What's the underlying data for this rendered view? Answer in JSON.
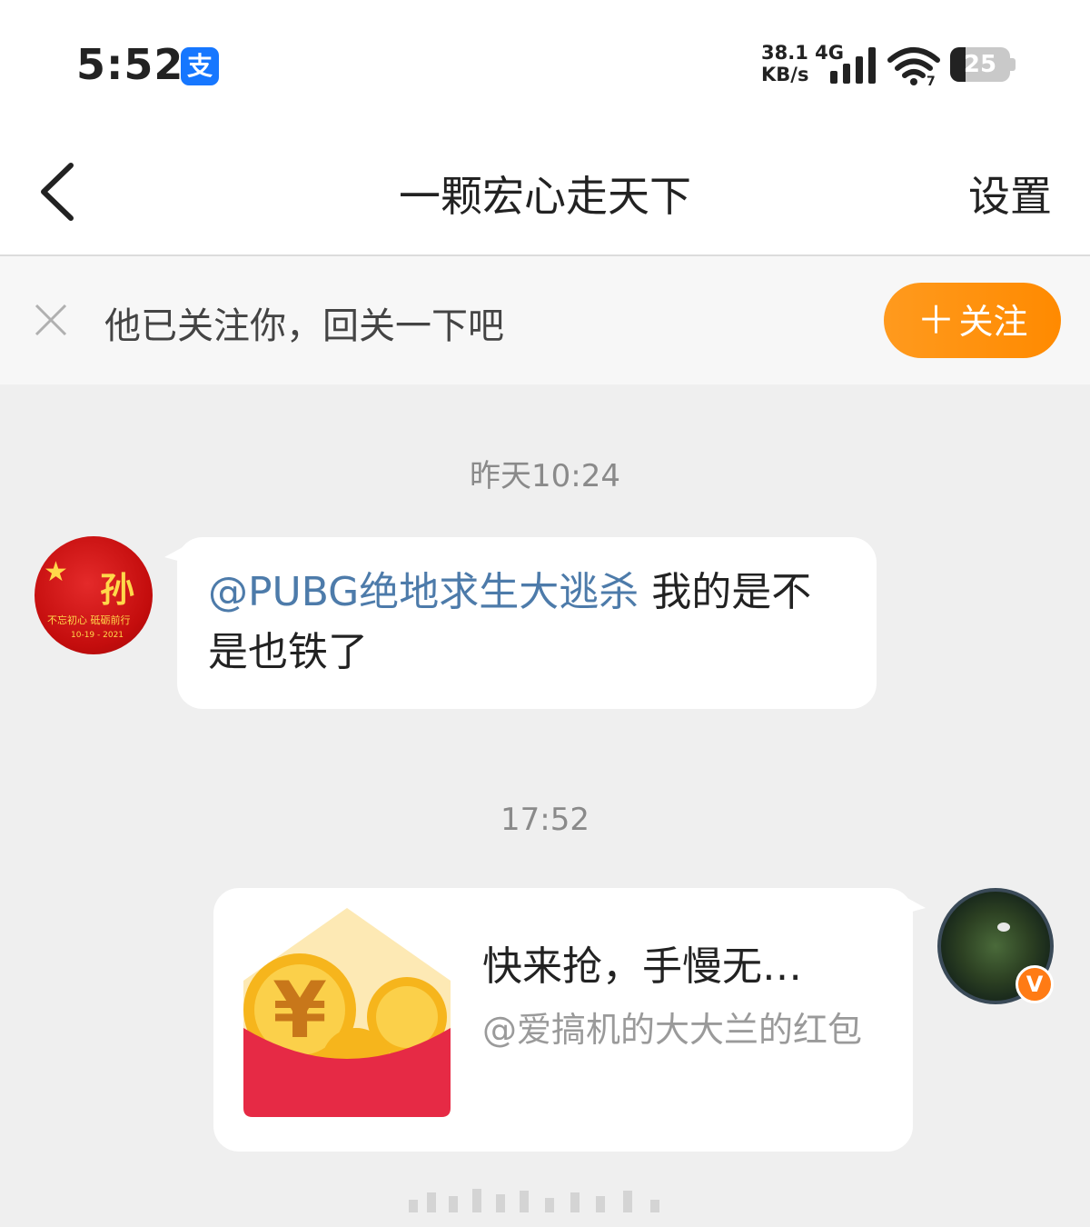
{
  "status_bar": {
    "time": "5:52",
    "app_icon_char": "支",
    "net_speed_value": "38.1",
    "net_speed_unit": "KB/s",
    "network_type": "4G",
    "wifi_badge": "7",
    "battery_level": 25,
    "icons": [
      "alipay-icon",
      "signal-icon",
      "wifi-icon",
      "battery-icon"
    ]
  },
  "header": {
    "title": "一颗宏心走天下",
    "settings_label": "设置"
  },
  "follow_banner": {
    "text": "他已关注你，回关一下吧",
    "button_plus": "＋",
    "button_label": "关注",
    "accent_color": "#ff8a00"
  },
  "chat": {
    "timestamp_1": "昨天10:24",
    "message_1": {
      "avatar_char": "孙",
      "avatar_text_line1": "不忘初心 砥砺前行",
      "avatar_text_line2": "10-19 - 2021",
      "mention": "@PUBG绝地求生大逃杀",
      "text": " 我的是不是也铁了"
    },
    "timestamp_2": "17:52",
    "message_2": {
      "card_title": "快来抢，手慢无…",
      "card_subtitle": "@爱搞机的大大兰的红包",
      "verified_badge": "V"
    }
  }
}
